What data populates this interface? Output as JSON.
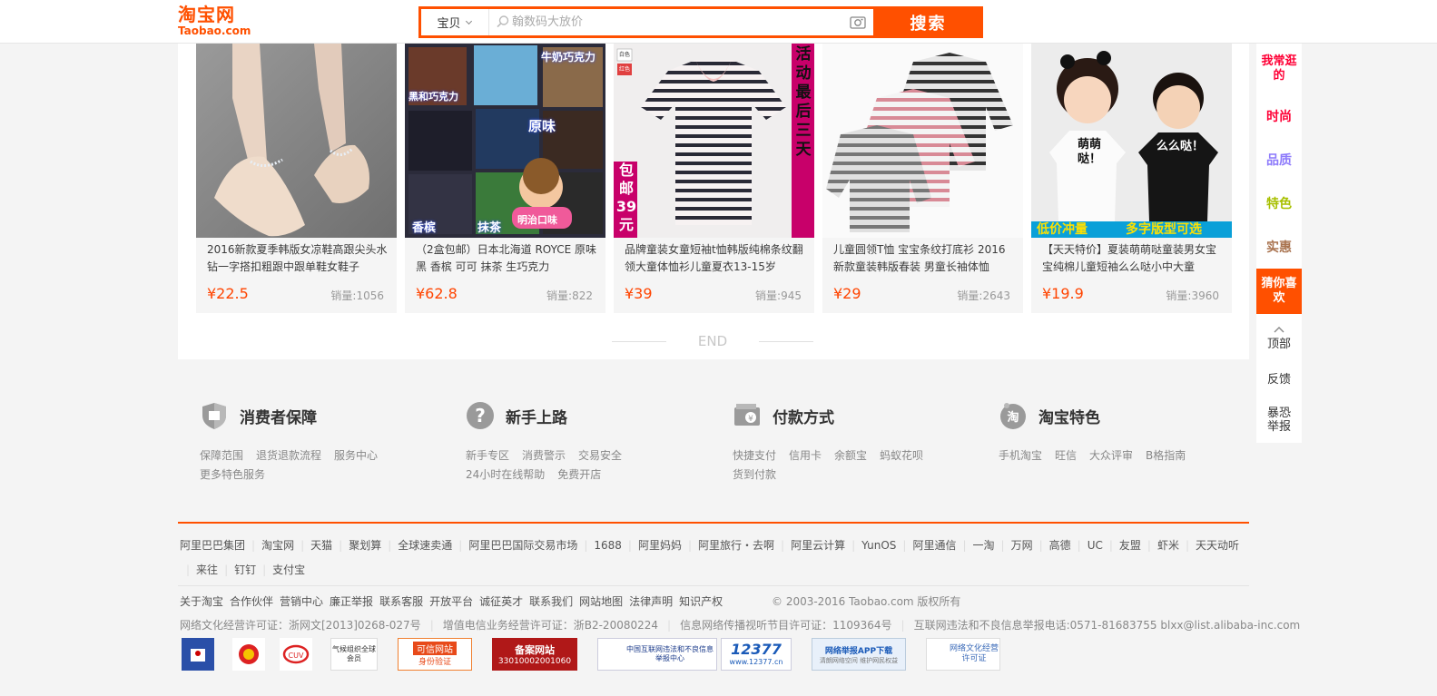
{
  "header": {
    "logo_cn": "淘宝网",
    "logo_en": "Taobao.com",
    "search_category": "宝贝",
    "search_placeholder": "翰数码大放价",
    "search_button": "搜索"
  },
  "products": [
    {
      "title": "2016新款夏季韩版女凉鞋高跟尖头水钻一字搭扣粗跟中跟单鞋女鞋子",
      "price": "¥22.5",
      "sales": "销量:1056"
    },
    {
      "title": "（2盒包邮）日本北海道 ROYCE 原味 黑 香槟 可可 抹茶 生巧克力",
      "price": "¥62.8",
      "sales": "销量:822",
      "overlay": {
        "left": "黑和巧克力",
        "right": "牛奶巧克力",
        "center": "原味",
        "bottom_left": "香槟",
        "bottom_center": "抹茶",
        "brand": "明治口味"
      }
    },
    {
      "title": "品牌童装女童短袖t恤韩版纯棉条纹翻领大童体恤衫儿童夏衣13-15岁",
      "price": "¥39",
      "sales": "销量:945",
      "overlay": {
        "banner": "活动最后三天",
        "promo": "包邮39元",
        "tag1": "白色",
        "tag2": "红色"
      }
    },
    {
      "title": "儿童圆领T恤 宝宝条纹打底衫 2016新款童装韩版春装 男童长袖体恤",
      "price": "¥29",
      "sales": "销量:2643"
    },
    {
      "title": "【天天特价】夏装萌萌哒童装男女宝宝纯棉儿童短袖么么哒小中大童",
      "price": "¥19.9",
      "sales": "销量:3960",
      "overlay": {
        "shirt1": "萌萌哒！",
        "shirt2": "么么哒！",
        "strip_left": "低价冲量",
        "strip_right": "多字版型可选"
      }
    }
  ],
  "end_text": "END",
  "sidebar": {
    "items": [
      "我常逛的",
      "时尚",
      "品质",
      "特色",
      "实惠",
      "猜你喜欢"
    ],
    "colors": [
      "#ff0036",
      "#ff0036",
      "#8d7afb",
      "#a8c001",
      "#a9734f",
      "#ffffff"
    ],
    "top": "顶部",
    "feedback": "反馈",
    "report": "暴恐举报"
  },
  "services": [
    {
      "title": "消费者保障",
      "links": [
        "保障范围",
        "退货退款流程",
        "服务中心",
        "更多特色服务"
      ],
      "icon": "shield-icon"
    },
    {
      "title": "新手上路",
      "links": [
        "新手专区",
        "消费警示",
        "交易安全",
        "24小时在线帮助",
        "免费开店"
      ],
      "icon": "question-icon"
    },
    {
      "title": "付款方式",
      "links": [
        "快捷支付",
        "信用卡",
        "余额宝",
        "蚂蚁花呗",
        "货到付款"
      ],
      "icon": "wallet-icon"
    },
    {
      "title": "淘宝特色",
      "links": [
        "手机淘宝",
        "旺信",
        "大众评审",
        "B格指南"
      ],
      "icon": "tao-icon"
    }
  ],
  "footer": {
    "group_links": [
      "阿里巴巴集团",
      "淘宝网",
      "天猫",
      "聚划算",
      "全球速卖通",
      "阿里巴巴国际交易市场",
      "1688",
      "阿里妈妈",
      "阿里旅行・去啊",
      "阿里云计算",
      "YunOS",
      "阿里通信",
      "一淘",
      "万网",
      "高德",
      "UC",
      "友盟",
      "虾米",
      "天天动听",
      "来往",
      "钉钉",
      "支付宝"
    ],
    "about_links": [
      "关于淘宝",
      "合作伙伴",
      "营销中心",
      "廉正举报",
      "联系客服",
      "开放平台",
      "诚征英才",
      "联系我们",
      "网站地图",
      "法律声明",
      "知识产权"
    ],
    "copyright": "© 2003-2016 Taobao.com 版权所有",
    "licenses": [
      "网络文化经营许可证：浙网文[2013]0268-027号",
      "增值电信业务经营许可证：浙B2-20080224",
      "信息网络传播视听节目许可证：1109364号",
      "互联网违法和不良信息举报电话:0571-81683755 blxx@list.alibaba-inc.com"
    ],
    "badges": {
      "cert": "可信网站",
      "cert_sub": "身份验证",
      "record": "备案网站",
      "record_no": "33010002001060",
      "report_center": "中国互联网违法和不良信息举报中心",
      "hotline": "12377",
      "hotline_url": "www.12377.cn",
      "app": "网络举报APP下载",
      "app_sub": "清朗网络空间 维护网民权益",
      "culture": "网络文化经营许可证",
      "member": "气候组织全球会员"
    }
  }
}
